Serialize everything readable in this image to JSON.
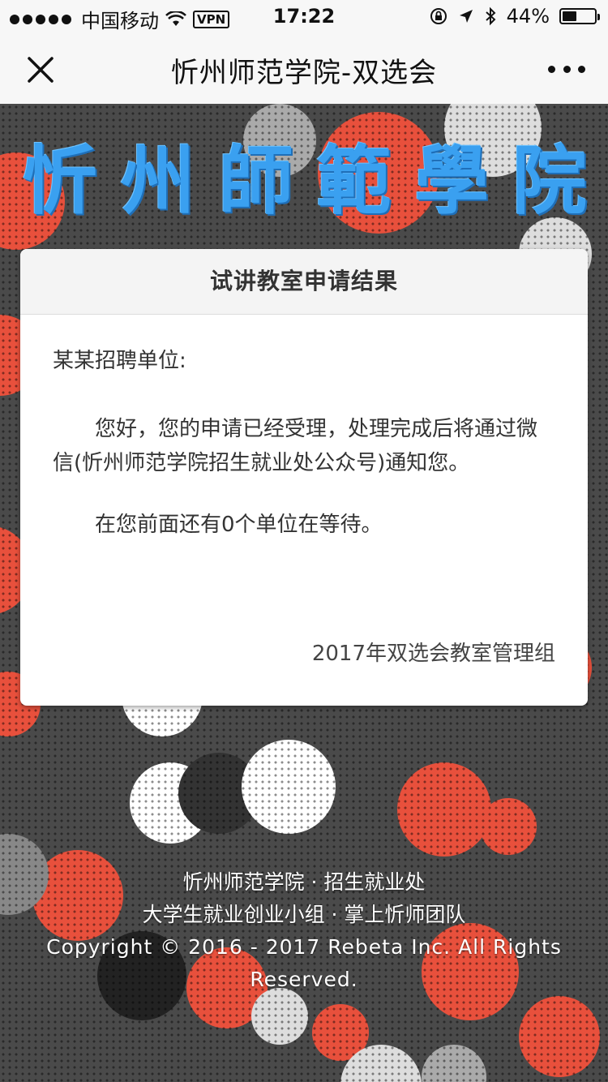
{
  "status_bar": {
    "carrier": "中国移动",
    "vpn": "VPN",
    "time": "17:22",
    "battery": "44%",
    "battery_level": 0.44
  },
  "navbar": {
    "title": "忻州师范学院-双选会"
  },
  "brand": {
    "chars": [
      "忻",
      "州",
      "師",
      "範",
      "學",
      "院"
    ],
    "color": "#3aa0f0"
  },
  "card": {
    "title": "试讲教室申请结果",
    "greeting": "某某招聘单位:",
    "message": "您好，您的申请已经受理，处理完成后将通过微信(忻州师范学院招生就业处公众号)通知您。",
    "queue": "在您前面还有0个单位在等待。",
    "signature": "2017年双选会教室管理组"
  },
  "footer": {
    "line1": "忻州师范学院 · 招生就业处",
    "line2": "大学生就业创业小组 · 掌上忻师团队",
    "copyright": "Copyright © 2016 - 2017 Rebeta Inc. All Rights Reserved."
  },
  "colors": {
    "bokeh_red": "#e8503c",
    "bokeh_white": "#eeeeee",
    "background": "#4a4a4a"
  }
}
